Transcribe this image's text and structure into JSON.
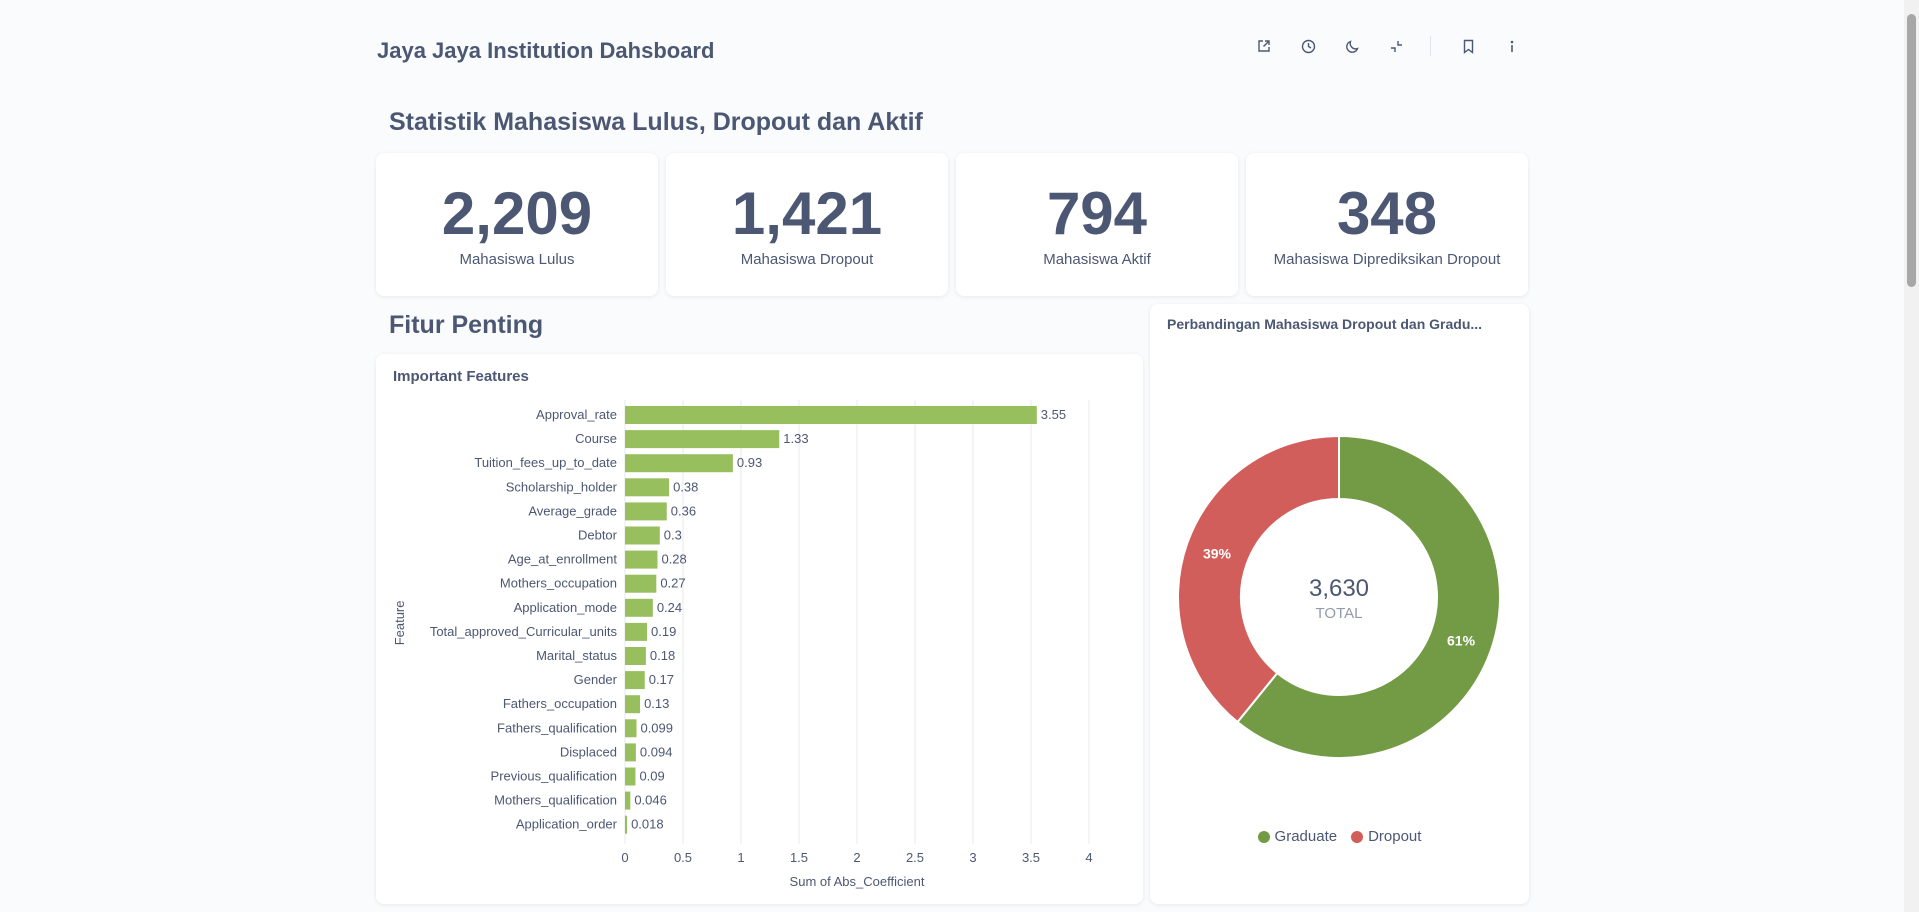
{
  "header": {
    "title": "Jaya Jaya Institution Dahsboard",
    "icons": [
      "external-link-icon",
      "clock-icon",
      "moon-icon",
      "collapse-icon",
      "bookmark-icon",
      "info-icon"
    ]
  },
  "sections": {
    "stats_title": "Statistik Mahasiswa Lulus, Dropout dan Aktif",
    "features_title": "Fitur Penting"
  },
  "scalars": [
    {
      "value": "2,209",
      "label": "Mahasiswa Lulus"
    },
    {
      "value": "1,421",
      "label": "Mahasiswa Dropout"
    },
    {
      "value": "794",
      "label": "Mahasiswa Aktif"
    },
    {
      "value": "348",
      "label": "Mahasiswa Diprediksikan Dropout"
    }
  ],
  "bar_card": {
    "title": "Important Features"
  },
  "donut_card": {
    "title": "Perbandingan Mahasiswa Dropout dan Gradu...",
    "total_value": "3,630",
    "total_label": "TOTAL"
  },
  "colors": {
    "bar": "#98bf5e",
    "graduate": "#739a44",
    "dropout": "#d15e5b",
    "text": "#4c5773"
  },
  "chart_data": [
    {
      "type": "bar",
      "orientation": "horizontal",
      "title": "Important Features",
      "xlabel": "Sum of Abs_Coefficient",
      "ylabel": "Feature",
      "xlim": [
        0,
        4
      ],
      "xticks": [
        "0",
        "0.5",
        "1",
        "1.5",
        "2",
        "2.5",
        "3",
        "3.5",
        "4"
      ],
      "grid": true,
      "categories": [
        "Approval_rate",
        "Course",
        "Tuition_fees_up_to_date",
        "Scholarship_holder",
        "Average_grade",
        "Debtor",
        "Age_at_enrollment",
        "Mothers_occupation",
        "Application_mode",
        "Total_approved_Curricular_units",
        "Marital_status",
        "Gender",
        "Fathers_occupation",
        "Fathers_qualification",
        "Displaced",
        "Previous_qualification",
        "Mothers_qualification",
        "Application_order"
      ],
      "values": [
        3.55,
        1.33,
        0.93,
        0.38,
        0.36,
        0.3,
        0.28,
        0.27,
        0.24,
        0.19,
        0.18,
        0.17,
        0.13,
        0.099,
        0.094,
        0.09,
        0.046,
        0.018
      ],
      "labels": [
        "3.55",
        "1.33",
        "0.93",
        "0.38",
        "0.36",
        "0.3",
        "0.28",
        "0.27",
        "0.24",
        "0.19",
        "0.18",
        "0.17",
        "0.13",
        "0.099",
        "0.094",
        "0.09",
        "0.046",
        "0.018"
      ]
    },
    {
      "type": "pie",
      "donut": true,
      "categories": [
        "Graduate",
        "Dropout"
      ],
      "values": [
        2209,
        1421
      ],
      "percent_labels": [
        "61%",
        "39%"
      ],
      "legend": "bottom"
    }
  ]
}
